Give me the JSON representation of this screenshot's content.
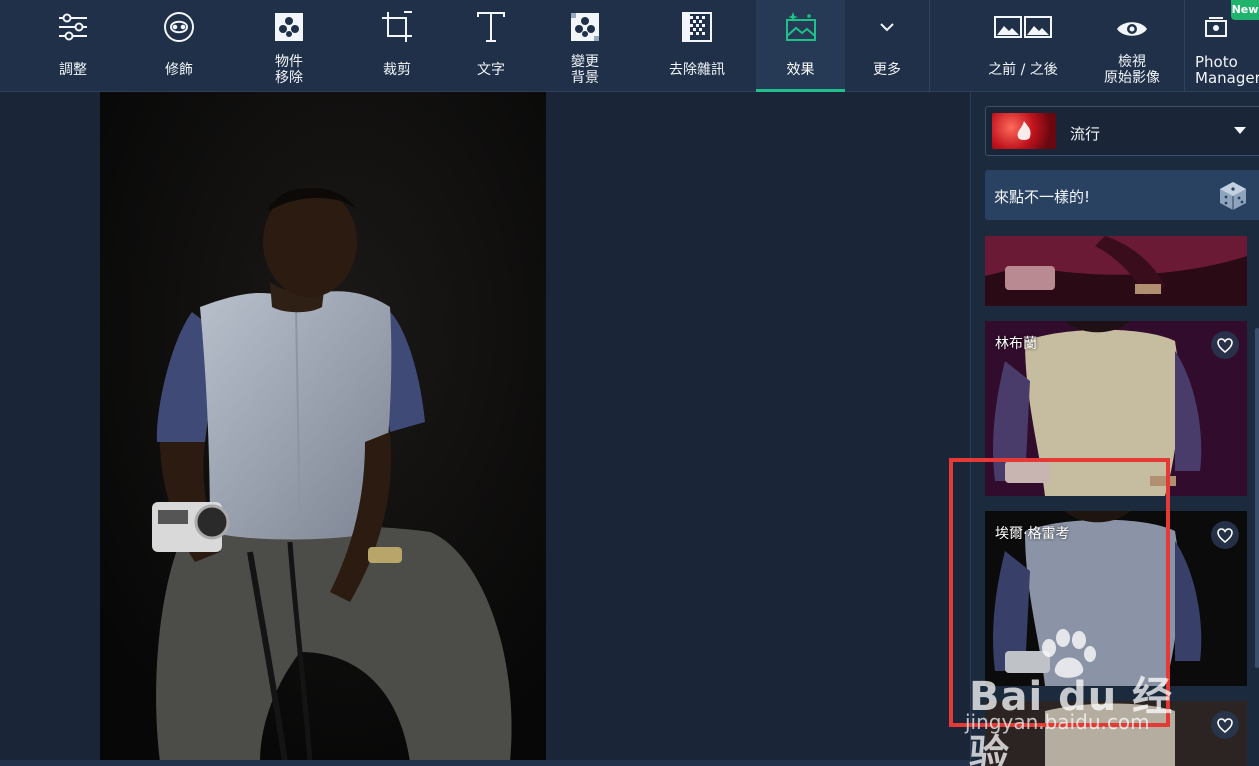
{
  "toolbar": {
    "tools": [
      {
        "label": "調整",
        "icon": "sliders-icon"
      },
      {
        "label": "修飾",
        "icon": "face-icon"
      },
      {
        "label": "物件\n移除",
        "icon": "object-remove-icon"
      },
      {
        "label": "裁剪",
        "icon": "crop-icon"
      },
      {
        "label": "文字",
        "icon": "text-icon"
      },
      {
        "label": "變更\n背景",
        "icon": "background-icon"
      },
      {
        "label": "去除雜訊",
        "icon": "denoise-icon"
      },
      {
        "label": "效果",
        "icon": "effects-icon",
        "active": true
      },
      {
        "label": "更多",
        "icon": "chevron-down-icon"
      },
      {
        "label": "之前 / 之後",
        "icon": "before-after-icon"
      },
      {
        "label": "檢視\n原始影像",
        "icon": "eye-icon"
      },
      {
        "label": "Photo\nManager",
        "icon": "photo-manager-icon",
        "badge": "New"
      }
    ],
    "accent_color": "#1fc08a"
  },
  "panel": {
    "category": {
      "value": "流行"
    },
    "surprise": {
      "label": "來點不一樣的!"
    },
    "effects": [
      {
        "name": ""
      },
      {
        "name": "林布蘭"
      },
      {
        "name": "埃爾·格雷考"
      },
      {
        "name": ""
      }
    ]
  },
  "watermark": {
    "line1": "Bai du 经验",
    "line2": "jingyan.baidu.com"
  }
}
